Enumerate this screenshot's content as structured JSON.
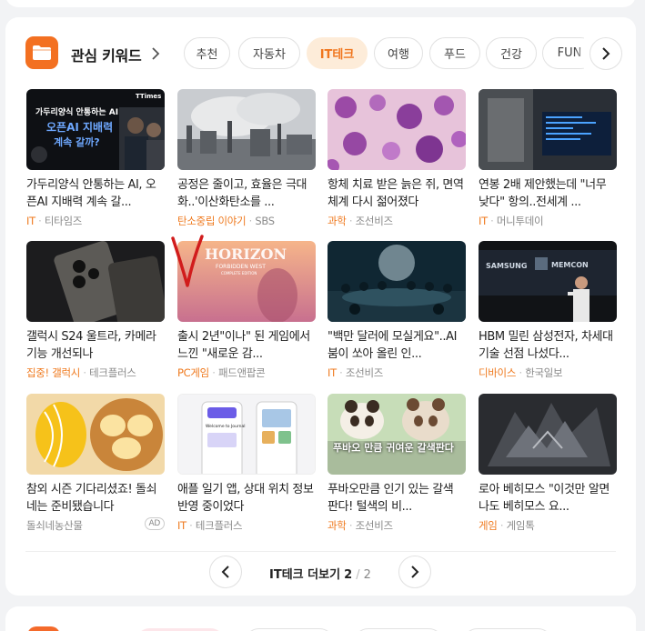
{
  "section": {
    "title": "관심 키워드",
    "chips": [
      {
        "label": "추천",
        "active": false
      },
      {
        "label": "자동차",
        "active": false
      },
      {
        "label": "IT테크",
        "active": true
      },
      {
        "label": "여행",
        "active": false
      },
      {
        "label": "푸드",
        "active": false
      },
      {
        "label": "건강",
        "active": false
      },
      {
        "label": "FUN",
        "active": false
      }
    ],
    "accent_color": "#f0761e",
    "icons": {
      "badge": "folder-icon",
      "title_arrow": "chevron-right-icon",
      "chip_next": "chevron-right-icon"
    }
  },
  "articles": [
    {
      "title": "가두리양식 안통하는 AI, 오픈AI 지배력 계속 갈...",
      "category": "IT",
      "source": "티타임즈",
      "thumb_text": "가두리양식 안통하는 AI 오픈AI 지배력 계속 갈까?",
      "thumb_brand": "TTimes"
    },
    {
      "title": "공정은 줄이고, 효율은 극대화..'이산화탄소를 ...",
      "category": "탄소중립 이야기",
      "source": "SBS"
    },
    {
      "title": "항체 치료 받은 늙은 쥐, 면역체계 다시 젊어졌다",
      "category": "과학",
      "source": "조선비즈"
    },
    {
      "title": "연봉 2배 제안했는데 \"너무 낮다\" 항의..전세계 ...",
      "category": "IT",
      "source": "머니투데이"
    },
    {
      "title": "갤럭시 S24 울트라, 카메라 기능 개선되나",
      "category": "집중! 갤럭시",
      "source": "테크플러스"
    },
    {
      "title": "출시 2년\"이나\" 된 게임에서 느낀 \"새로운 감...",
      "category": "PC게임",
      "source": "패드앤팝콘",
      "thumb_text": "HORIZON",
      "thumb_sub": "FORBIDDEN WEST",
      "thumb_sub2": "COMPLETE EDITION"
    },
    {
      "title": "\"백만 달러에 모실게요\"..AI 붐이 쏘아 올린 인...",
      "category": "IT",
      "source": "조선비즈"
    },
    {
      "title": "HBM 밀린 삼성전자, 차세대 기술 선점 나섰다...",
      "category": "디바이스",
      "source": "한국일보",
      "thumb_text": "SAMSUNG",
      "thumb_sub": "MEMCON"
    },
    {
      "title": "참외 시즌 기다리셨죠! 돌쇠네는 준비됐습니다",
      "category": "",
      "source": "돌쇠네농산물",
      "ad": "AD"
    },
    {
      "title": "애플 일기 앱, 상대 위치 정보 반영 중이었다",
      "category": "IT",
      "source": "테크플러스",
      "thumb_text": "Welcome to Journal"
    },
    {
      "title": "푸바오만큼 인기 있는 갈색 판다! 털색의 비...",
      "category": "과학",
      "source": "조선비즈",
      "thumb_text": "푸바오 만큼 귀여운 갈색판다"
    },
    {
      "title": "로아 베히모스 \"이것만 알면 나도 베히모스 요...",
      "category": "게임",
      "source": "게임톡"
    }
  ],
  "pager": {
    "label": "IT테크 더보기",
    "current": "2",
    "separator": "/",
    "total": "2",
    "icons": {
      "prev": "chevron-left-icon",
      "next": "chevron-right-icon"
    }
  }
}
